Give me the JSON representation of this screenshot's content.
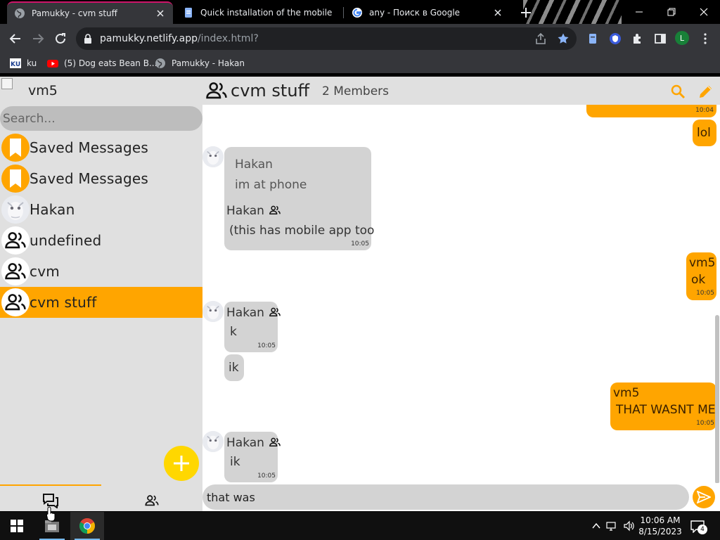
{
  "browser": {
    "tabs": [
      {
        "title": "Pamukky - cvm stuff",
        "active": true
      },
      {
        "title": "Quick installation of the mobile s",
        "active": false
      },
      {
        "title": "any - Поиск в Google",
        "active": false
      }
    ],
    "url_host": "pamukky.netlify.app",
    "url_path": "/index.html?",
    "profile_initial": "L",
    "bookmarks": [
      {
        "label": "ku",
        "icon": "ku-icon"
      },
      {
        "label": "(5) Dog eats Bean B...",
        "icon": "youtube-icon"
      },
      {
        "label": "Pamukky - Hakan",
        "icon": "globe-icon"
      }
    ]
  },
  "sidebar": {
    "username": "vm5",
    "search_placeholder": "Search...",
    "chats": [
      {
        "name": "Saved Messages",
        "avatar": "bookmark-icon"
      },
      {
        "name": "Saved Messages",
        "avatar": "bookmark-icon"
      },
      {
        "name": "Hakan",
        "avatar": "user-photo"
      },
      {
        "name": "undefined",
        "avatar": "group-icon"
      },
      {
        "name": "cvm",
        "avatar": "group-icon"
      },
      {
        "name": "cvm stuff",
        "avatar": "group-icon",
        "active": true
      }
    ]
  },
  "chat": {
    "title": "cvm stuff",
    "members": "2 Members",
    "messages": [
      {
        "dir": "out",
        "text": "",
        "time": "10:04"
      },
      {
        "dir": "out",
        "text": "lol",
        "time": ""
      },
      {
        "dir": "in",
        "quote_sender": "Hakan",
        "quote_text": "im at phone",
        "sender": "Hakan",
        "text": "(this has mobile app too",
        "time": "10:05"
      },
      {
        "dir": "out",
        "sender": "vm5",
        "text": "ok",
        "time": "10:05"
      },
      {
        "dir": "in",
        "sender": "Hakan",
        "text": "k",
        "time": "10:05"
      },
      {
        "dir": "in",
        "text": "ik",
        "time": ""
      },
      {
        "dir": "out",
        "sender": "vm5",
        "text": "THAT WASNT ME",
        "time": "10:05"
      },
      {
        "dir": "in",
        "sender": "Hakan",
        "text": "ik",
        "time": "10:05"
      }
    ],
    "composer_value": "that was "
  },
  "taskbar": {
    "time": "10:06 AM",
    "date": "8/15/2023",
    "notifications": "4"
  },
  "colors": {
    "accent": "#ffa500",
    "fab": "#ffd700",
    "bubble_in": "#d3d3d3",
    "sidebar_bg": "#e0e0e0"
  }
}
